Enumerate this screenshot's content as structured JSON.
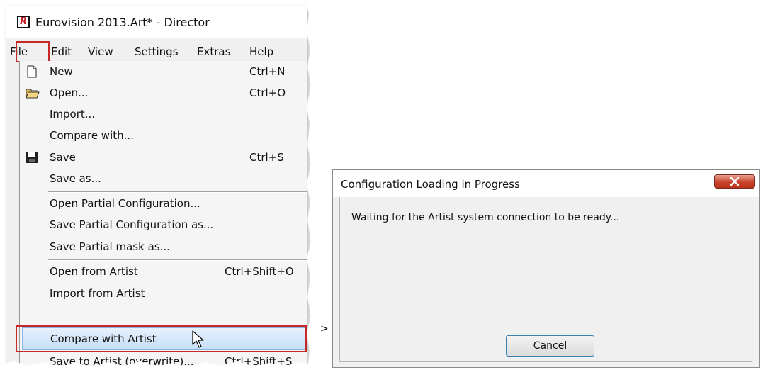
{
  "director": {
    "title": "Eurovision 2013.Art* - Director",
    "logo": "R",
    "menu": [
      "File",
      "Edit",
      "View",
      "Settings",
      "Extras",
      "Help"
    ],
    "file_menu": [
      {
        "label": "New",
        "shortcut": "Ctrl+N",
        "icon": "new-file-icon"
      },
      {
        "label": "Open...",
        "shortcut": "Ctrl+O",
        "icon": "open-folder-icon"
      },
      {
        "label": "Import...",
        "shortcut": ""
      },
      {
        "label": "Compare with...",
        "shortcut": ""
      },
      {
        "label": "Save",
        "shortcut": "Ctrl+S",
        "icon": "save-disk-icon"
      },
      {
        "label": "Save as...",
        "shortcut": ""
      },
      {
        "label": "Open Partial Configuration...",
        "shortcut": ""
      },
      {
        "label": "Save Partial Configuration as...",
        "shortcut": ""
      },
      {
        "label": "Save Partial mask as...",
        "shortcut": ""
      },
      {
        "label": "Open from Artist",
        "shortcut": "Ctrl+Shift+O"
      },
      {
        "label": "Import from Artist",
        "shortcut": ""
      },
      {
        "label": "Compare with Artist",
        "shortcut": "",
        "highlighted": true
      },
      {
        "label": "Save to Artist (overwrite)...",
        "shortcut": "Ctrl+Shift+S"
      }
    ]
  },
  "arrow_mark": ">",
  "dialog": {
    "title": "Configuration Loading in Progress",
    "close_icon": "close-x-icon",
    "message": "Waiting for the Artist system connection to be ready...",
    "cancel_label": "Cancel"
  },
  "colors": {
    "highlight_border": "#c62828",
    "menu_hover": "#c6def7",
    "close_button": "#c8442c",
    "button_focus_border": "#3c7fb1"
  }
}
